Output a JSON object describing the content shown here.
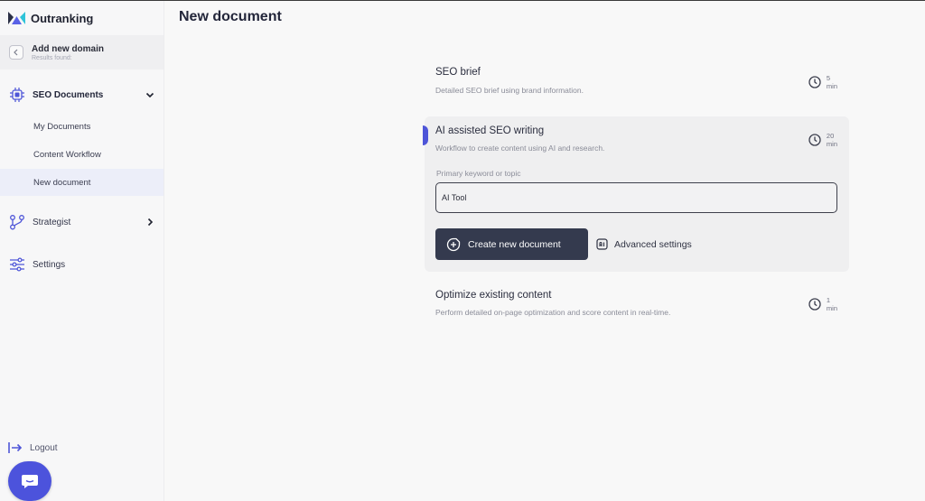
{
  "app": {
    "name": "Outranking",
    "brand_color": "#4e55d8"
  },
  "domain": {
    "title": "Add new domain",
    "subtitle": "Results found:"
  },
  "sidebar": {
    "seo_documents": {
      "label": "SEO Documents",
      "expanded": true
    },
    "sub_items": [
      {
        "label": "My Documents",
        "active": false
      },
      {
        "label": "Content Workflow",
        "active": false
      },
      {
        "label": "New document",
        "active": true
      }
    ],
    "strategist": {
      "label": "Strategist"
    },
    "settings": {
      "label": "Settings"
    },
    "logout": {
      "label": "Logout"
    }
  },
  "page": {
    "title": "New document"
  },
  "cards": [
    {
      "title": "SEO brief",
      "description": "Detailed SEO brief using brand information.",
      "time_value": "5",
      "time_unit": "min"
    },
    {
      "title": "AI assisted SEO writing",
      "description": "Workflow to create content using AI and research.",
      "time_value": "20",
      "time_unit": "min"
    },
    {
      "title": "Optimize existing content",
      "description": "Perform detailed on-page optimization and score content in real-time.",
      "time_value": "1",
      "time_unit": "min"
    }
  ],
  "form": {
    "label": "Primary keyword or topic",
    "value": "AI Tool",
    "create_label": "Create new document",
    "advanced_label": "Advanced settings"
  }
}
